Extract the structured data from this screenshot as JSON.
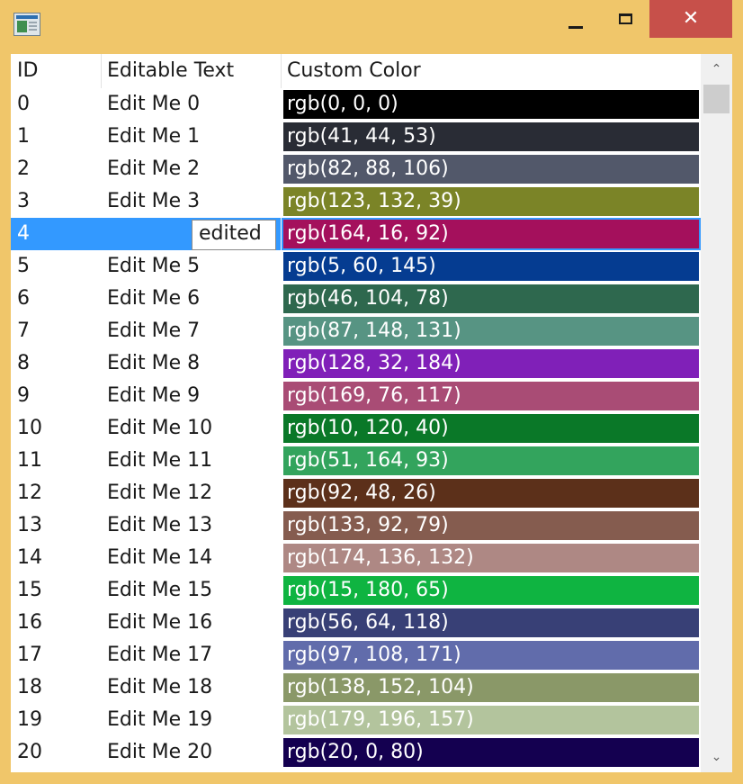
{
  "window": {
    "title": "",
    "controls": {
      "minimize": "minimize",
      "maximize": "maximize",
      "close": "✕"
    }
  },
  "colors": {
    "accent": "#3399ff",
    "titlebar": "#f0c66a",
    "close": "#c7504a"
  },
  "table": {
    "headers": [
      "ID",
      "Editable Text",
      "Custom Color"
    ],
    "editing_value": "edited",
    "selected_row": 4,
    "rows": [
      {
        "id": "0",
        "text": "Edit Me 0",
        "color_label": "rgb(0, 0, 0)",
        "color": "#000000"
      },
      {
        "id": "1",
        "text": "Edit Me 1",
        "color_label": "rgb(41, 44, 53)",
        "color": "#292c35"
      },
      {
        "id": "2",
        "text": "Edit Me 2",
        "color_label": "rgb(82, 88, 106)",
        "color": "#52586a"
      },
      {
        "id": "3",
        "text": "Edit Me 3",
        "color_label": "rgb(123, 132, 39)",
        "color": "#7b8427"
      },
      {
        "id": "4",
        "text": "edited",
        "color_label": "rgb(164, 16, 92)",
        "color": "#a4105c"
      },
      {
        "id": "5",
        "text": "Edit Me 5",
        "color_label": "rgb(5, 60, 145)",
        "color": "#053c91"
      },
      {
        "id": "6",
        "text": "Edit Me 6",
        "color_label": "rgb(46, 104, 78)",
        "color": "#2e684e"
      },
      {
        "id": "7",
        "text": "Edit Me 7",
        "color_label": "rgb(87, 148, 131)",
        "color": "#579483"
      },
      {
        "id": "8",
        "text": "Edit Me 8",
        "color_label": "rgb(128, 32, 184)",
        "color": "#8020b8"
      },
      {
        "id": "9",
        "text": "Edit Me 9",
        "color_label": "rgb(169, 76, 117)",
        "color": "#a94c75"
      },
      {
        "id": "10",
        "text": "Edit Me 10",
        "color_label": "rgb(10, 120, 40)",
        "color": "#0a7828"
      },
      {
        "id": "11",
        "text": "Edit Me 11",
        "color_label": "rgb(51, 164, 93)",
        "color": "#33a45d"
      },
      {
        "id": "12",
        "text": "Edit Me 12",
        "color_label": "rgb(92, 48, 26)",
        "color": "#5c301a"
      },
      {
        "id": "13",
        "text": "Edit Me 13",
        "color_label": "rgb(133, 92, 79)",
        "color": "#855c4f"
      },
      {
        "id": "14",
        "text": "Edit Me 14",
        "color_label": "rgb(174, 136, 132)",
        "color": "#ae8884"
      },
      {
        "id": "15",
        "text": "Edit Me 15",
        "color_label": "rgb(15, 180, 65)",
        "color": "#0fb441"
      },
      {
        "id": "16",
        "text": "Edit Me 16",
        "color_label": "rgb(56, 64, 118)",
        "color": "#384076"
      },
      {
        "id": "17",
        "text": "Edit Me 17",
        "color_label": "rgb(97, 108, 171)",
        "color": "#616cab"
      },
      {
        "id": "18",
        "text": "Edit Me 18",
        "color_label": "rgb(138, 152, 104)",
        "color": "#8a9868"
      },
      {
        "id": "19",
        "text": "Edit Me 19",
        "color_label": "rgb(179, 196, 157)",
        "color": "#b3c49d"
      },
      {
        "id": "20",
        "text": "Edit Me 20",
        "color_label": "rgb(20, 0, 80)",
        "color": "#140050"
      }
    ]
  },
  "scrollbar": {
    "up_icon": "chevron-up-icon",
    "down_icon": "chevron-down-icon",
    "up_glyph": "⌃",
    "down_glyph": "⌄"
  }
}
